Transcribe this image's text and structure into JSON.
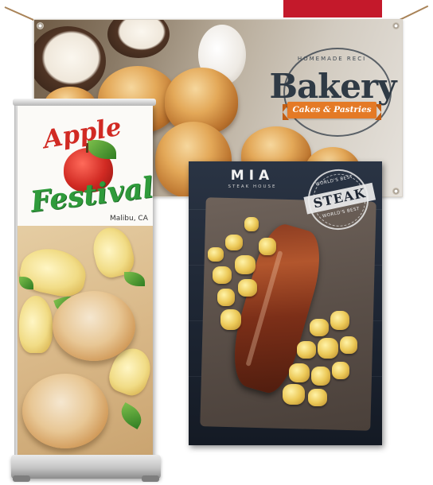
{
  "bakery_banner": {
    "arc_text": "HOMEMADE RECI",
    "brand": "Bakery",
    "tagline": "Cakes & Pastries"
  },
  "festival_standee": {
    "title_line1": "Apple",
    "title_line2": "Festival",
    "location": "Malibu, CA"
  },
  "steak_poster": {
    "name": "MIA",
    "subtitle": "STEAK HOUSE",
    "stamp_word": "STEAK",
    "stamp_top": "WORLD'S BEST",
    "stamp_bottom": "WORLD'S BEST"
  },
  "colors": {
    "banner_accent": "#c4192b",
    "ribbon_orange": "#e47a26",
    "apple_red": "#d12a23",
    "festival_green": "#2f9b3b",
    "poster_navy": "#1c2431"
  }
}
